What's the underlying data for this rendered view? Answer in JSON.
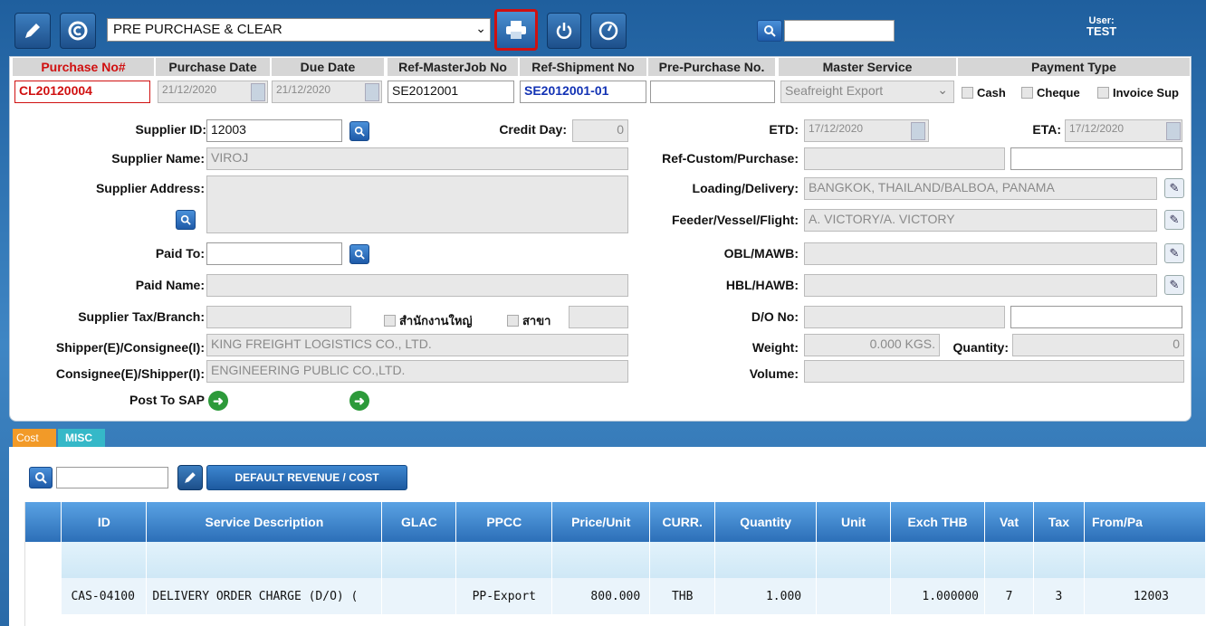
{
  "toolbar": {
    "doc_type": "PRE PURCHASE & CLEAR",
    "user_label": "User:",
    "user_name": "TEST",
    "search_value": ""
  },
  "headers": {
    "purchase_no": "Purchase No#",
    "purchase_date": "Purchase Date",
    "due_date": "Due Date",
    "ref_masterjob": "Ref-MasterJob No",
    "ref_shipment": "Ref-Shipment No",
    "pre_purchase": "Pre-Purchase No.",
    "master_service": "Master Service",
    "payment_type": "Payment Type"
  },
  "values": {
    "purchase_no": "CL20120004",
    "purchase_date": "21/12/2020",
    "due_date": "21/12/2020",
    "ref_masterjob": "SE2012001",
    "ref_shipment": "SE2012001-01",
    "pre_purchase": "",
    "master_service": "Seafreight Export"
  },
  "payment": {
    "cash": "Cash",
    "cheque": "Cheque",
    "invoice_sup": "Invoice Sup"
  },
  "labels": {
    "supplier_id": "Supplier ID:",
    "credit_day": "Credit Day:",
    "etd": "ETD:",
    "eta": "ETA:",
    "supplier_name": "Supplier  Name:",
    "ref_custom": "Ref-Custom/Purchase:",
    "supplier_address": "Supplier Address:",
    "loading": "Loading/Delivery:",
    "feeder": "Feeder/Vessel/Flight:",
    "paid_to": "Paid To:",
    "obl": "OBL/MAWB:",
    "paid_name": "Paid Name:",
    "hbl": "HBL/HAWB:",
    "supplier_tax": "Supplier Tax/Branch:",
    "head_office": "สำนักงานใหญ่",
    "branch": "สาขา",
    "do_no": "D/O No:",
    "shipper": "Shipper(E)/Consignee(I):",
    "weight": "Weight:",
    "quantity": "Quantity:",
    "consignee": "Consignee(E)/Shipper(I):",
    "volume": "Volume:",
    "post_sap": "Post To SAP"
  },
  "fields": {
    "supplier_id": "12003",
    "credit_day": "0",
    "etd": "17/12/2020",
    "eta": "17/12/2020",
    "supplier_name": "VIROJ",
    "loading": "BANGKOK, THAILAND/BALBOA, PANAMA",
    "feeder": "A. VICTORY/A. VICTORY",
    "shipper": "KING FREIGHT LOGISTICS CO., LTD.",
    "consignee": "ENGINEERING PUBLIC CO.,LTD.",
    "weight": "0.000 KGS.",
    "quantity": "0"
  },
  "tabs": {
    "cost": "Cost",
    "misc": "MISC"
  },
  "grid_toolbar": {
    "default_btn": "DEFAULT REVENUE / COST"
  },
  "grid": {
    "columns": [
      "ID",
      "Service Description",
      "GLAC",
      "PPCC",
      "Price/Unit",
      "CURR.",
      "Quantity",
      "Unit",
      "Exch THB",
      "Vat",
      "Tax",
      "From/Pa"
    ],
    "row": [
      "CAS-04100",
      "DELIVERY ORDER CHARGE (D/O) (",
      "",
      "PP-Export",
      "800.000",
      "THB",
      "1.000",
      "",
      "1.000000",
      "7",
      "3",
      "12003"
    ]
  }
}
